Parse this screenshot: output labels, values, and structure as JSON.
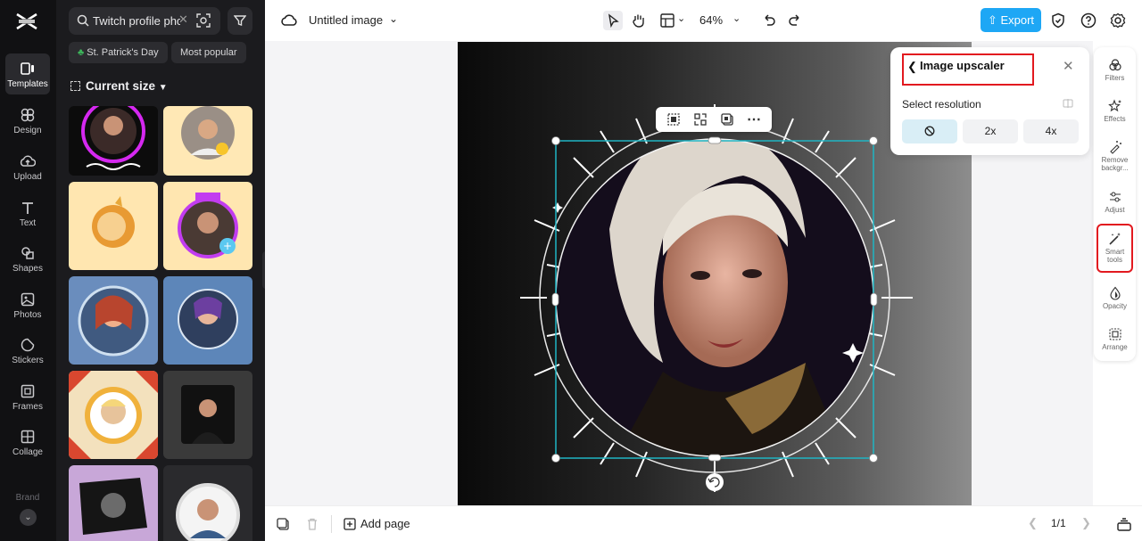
{
  "rail": {
    "items": [
      {
        "label": "Templates"
      },
      {
        "label": "Design"
      },
      {
        "label": "Upload"
      },
      {
        "label": "Text"
      },
      {
        "label": "Shapes"
      },
      {
        "label": "Photos"
      },
      {
        "label": "Stickers"
      },
      {
        "label": "Frames"
      },
      {
        "label": "Collage"
      },
      {
        "label": "Brand"
      }
    ]
  },
  "panel": {
    "search_value": "Twitch profile pho",
    "chips": [
      "St. Patrick's Day",
      "Most popular"
    ],
    "size_heading": "Current size"
  },
  "topbar": {
    "doc_title": "Untitled image",
    "zoom": "64%",
    "export_label": "Export"
  },
  "popup": {
    "title": "Image upscaler",
    "subtitle": "Select resolution",
    "options": [
      "2x",
      "4x"
    ]
  },
  "tools": {
    "filters": "Filters",
    "effects": "Effects",
    "remove_bg_1": "Remove",
    "remove_bg_2": "backgr...",
    "adjust": "Adjust",
    "smart_1": "Smart",
    "smart_2": "tools",
    "opacity": "Opacity",
    "arrange": "Arrange"
  },
  "bottombar": {
    "add_page": "Add page",
    "pager": "1/1"
  },
  "colors": {
    "accent": "#1ea7f5",
    "highlight": "#e2191f",
    "selection": "#1fb5c4"
  }
}
